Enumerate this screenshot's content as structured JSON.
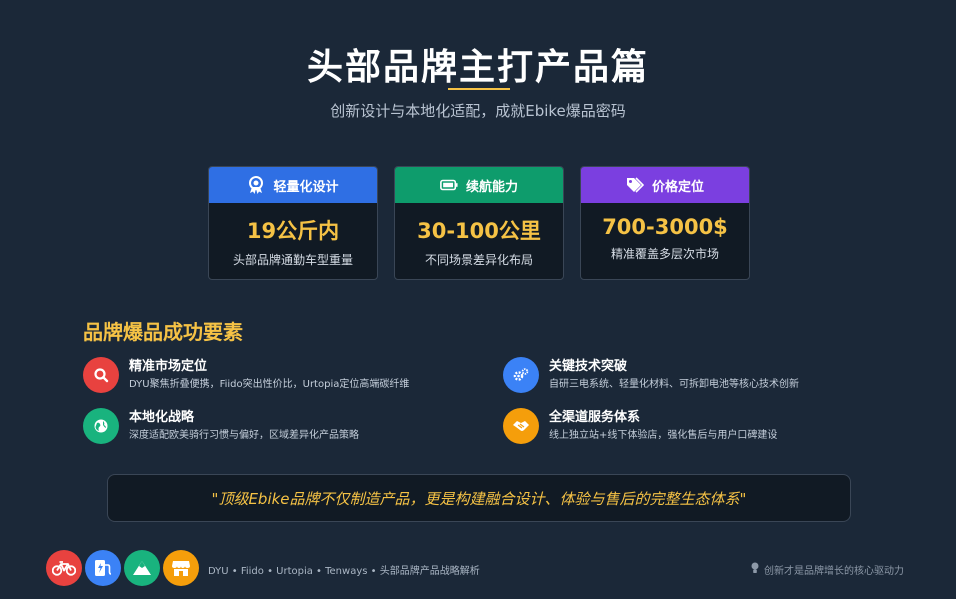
{
  "header": {
    "title": "头部品牌主打产品篇",
    "subtitle": "创新设计与本地化适配，成就Ebike爆品密码"
  },
  "cards": [
    {
      "label": "轻量化设计",
      "value": "19公斤内",
      "desc": "头部品牌通勤车型重量",
      "color": "#2f6fe4",
      "icon": "award-icon"
    },
    {
      "label": "续航能力",
      "value": "30-100公里",
      "desc": "不同场景差异化布局",
      "color": "#0e9c6c",
      "icon": "battery-icon"
    },
    {
      "label": "价格定位",
      "value": "700-3000$",
      "desc": "精准覆盖多层次市场",
      "color": "#7b3fe0",
      "icon": "tags-icon"
    }
  ],
  "section": {
    "title": "品牌爆品成功要素"
  },
  "factors": [
    {
      "title": "精准市场定位",
      "desc": "DYU聚焦折叠便携，Fiido突出性价比，Urtopia定位高端碳纤维",
      "color": "#e8423f",
      "icon": "search-icon"
    },
    {
      "title": "关键技术突破",
      "desc": "自研三电系统、轻量化材料、可拆卸电池等核心技术创新",
      "color": "#3b82f6",
      "icon": "cogs-icon"
    },
    {
      "title": "本地化战略",
      "desc": "深度适配欧美骑行习惯与偏好，区域差异化产品策略",
      "color": "#19b37e",
      "icon": "globe-icon"
    },
    {
      "title": "全渠道服务体系",
      "desc": "线上独立站+线下体验店，强化售后与用户口碑建设",
      "color": "#f59e0b",
      "icon": "handshake-icon"
    }
  ],
  "quote": "\"顶级Ebike品牌不仅制造产品，更是构建融合设计、体验与售后的完整生态体系\"",
  "footer": {
    "logos": [
      {
        "icon": "bicycle-icon",
        "color": "#e8423f"
      },
      {
        "icon": "charging-station-icon",
        "color": "#3b82f6"
      },
      {
        "icon": "mountain-icon",
        "color": "#19b37e"
      },
      {
        "icon": "store-icon",
        "color": "#f59e0b"
      }
    ],
    "brands_text": "DYU • Fiido • Urtopia • Tenways • 头部品牌产品战略解析",
    "tagline": "创新才是品牌增长的核心驱动力",
    "tagline_icon": "lightbulb-icon"
  }
}
